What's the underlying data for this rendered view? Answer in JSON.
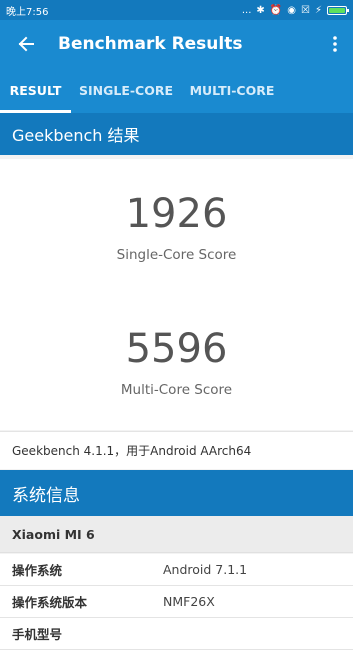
{
  "status_bar": {
    "time": "晚上7:56",
    "dots": "...",
    "bluetooth": "✱",
    "alarm": "⏰",
    "wifi": "◉",
    "sim": "☒",
    "charging": "⚡"
  },
  "app_bar": {
    "title": "Benchmark Results"
  },
  "tabs": [
    {
      "label": "RESULT",
      "active": true
    },
    {
      "label": "SINGLE-CORE",
      "active": false
    },
    {
      "label": "MULTI-CORE",
      "active": false
    }
  ],
  "results": {
    "header": "Geekbench 结果",
    "single_core": {
      "value": "1926",
      "label": "Single-Core Score"
    },
    "multi_core": {
      "value": "5596",
      "label": "Multi-Core Score"
    },
    "version_text": "Geekbench 4.1.1，用于Android AArch64"
  },
  "system_info": {
    "header": "系统信息",
    "device": "Xiaomi MI 6",
    "rows": [
      {
        "key": "操作系统",
        "value": "Android 7.1.1"
      },
      {
        "key": "操作系统版本",
        "value": "NMF26X"
      },
      {
        "key": "手机型号",
        "value": ""
      }
    ]
  },
  "colors": {
    "status_bar": "#1379bd",
    "app_bar": "#1a8ad0",
    "section_header": "#1379bd"
  }
}
